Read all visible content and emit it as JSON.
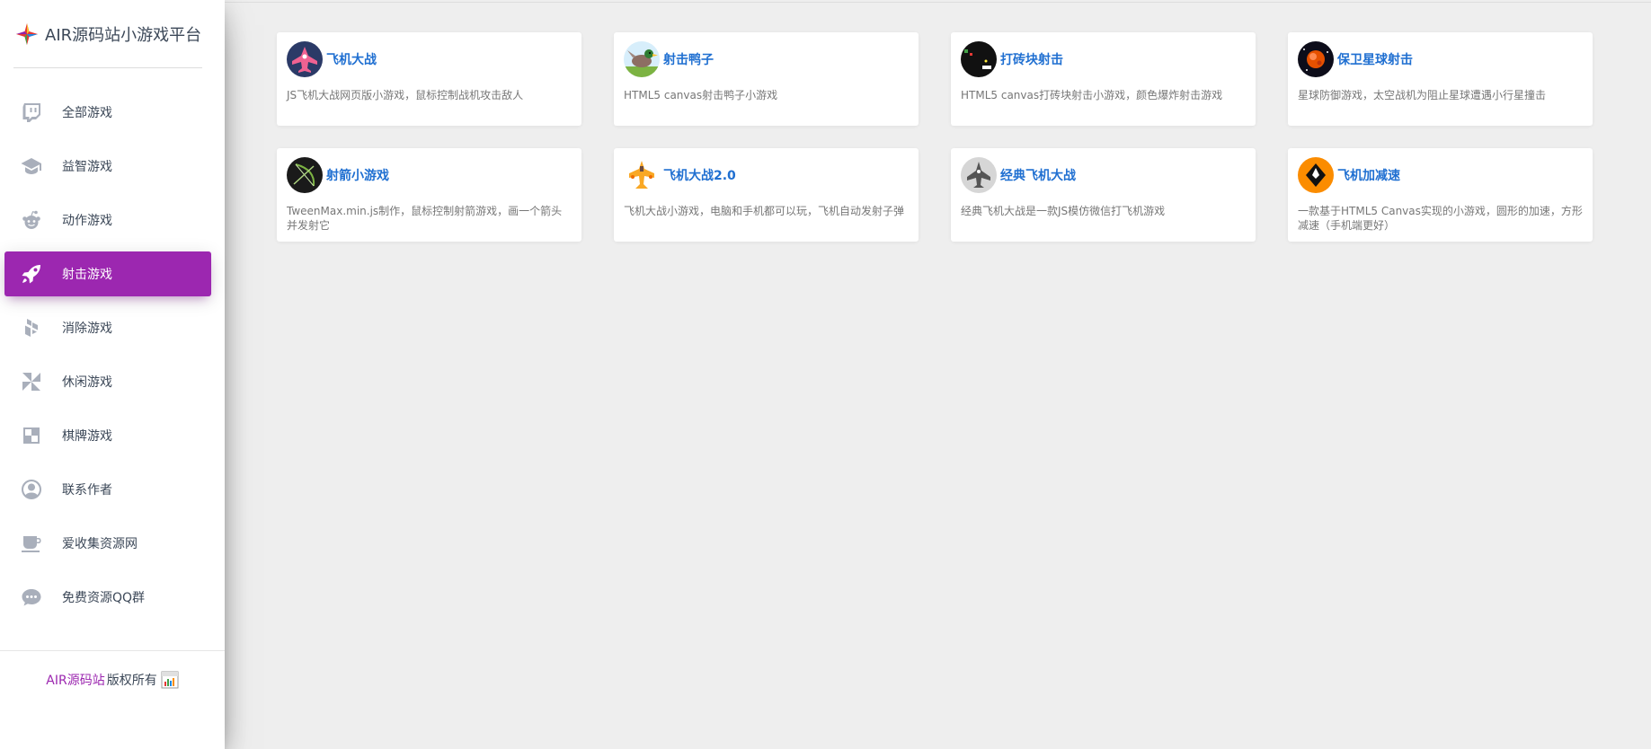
{
  "site": {
    "title": "AIR源码站小游戏平台",
    "logo_icon": "star-logo-icon"
  },
  "nav": {
    "items": [
      {
        "label": "全部游戏",
        "icon": "twitch-icon",
        "active": false
      },
      {
        "label": "益智游戏",
        "icon": "graduation-cap-icon",
        "active": false
      },
      {
        "label": "动作游戏",
        "icon": "reddit-icon",
        "active": false
      },
      {
        "label": "射击游戏",
        "icon": "rocket-icon",
        "active": true
      },
      {
        "label": "消除游戏",
        "icon": "hubspot-icon",
        "active": false
      },
      {
        "label": "休闲游戏",
        "icon": "pinwheel-icon",
        "active": false
      },
      {
        "label": "棋牌游戏",
        "icon": "checkerboard-icon",
        "active": false
      },
      {
        "label": "联系作者",
        "icon": "user-circle-icon",
        "active": false
      },
      {
        "label": "爱收集资源网",
        "icon": "coffee-icon",
        "active": false
      },
      {
        "label": "免费资源QQ群",
        "icon": "chat-bubble-icon",
        "active": false
      }
    ]
  },
  "footer": {
    "link": "AIR源码站",
    "text": "版权所有",
    "icon": "cnzz-stats-icon"
  },
  "games": [
    {
      "title": "飞机大战",
      "desc": "JS飞机大战网页版小游戏，鼠标控制战机攻击敌人",
      "thumb": "plane-thumb-icon"
    },
    {
      "title": "射击鸭子",
      "desc": "HTML5 canvas射击鸭子小游戏",
      "thumb": "duck-thumb-icon"
    },
    {
      "title": "打砖块射击",
      "desc": "HTML5 canvas打砖块射击小游戏，颜色爆炸射击游戏",
      "thumb": "brick-thumb-icon"
    },
    {
      "title": "保卫星球射击",
      "desc": "星球防御游戏，太空战机为阻止星球遭遇小行星撞击",
      "thumb": "planet-thumb-icon"
    },
    {
      "title": "射箭小游戏",
      "desc": "TweenMax.min.js制作，鼠标控制射箭游戏，画一个箭头并发射它",
      "thumb": "bow-thumb-icon"
    },
    {
      "title": "飞机大战2.0",
      "desc": "飞机大战小游戏，电脑和手机都可以玩，飞机自动发射子弹",
      "thumb": "plane2-thumb-icon"
    },
    {
      "title": "经典飞机大战",
      "desc": "经典飞机大战是一款JS模仿微信打飞机游戏",
      "thumb": "classic-plane-thumb-icon"
    },
    {
      "title": "飞机加减速",
      "desc": "一款基于HTML5 Canvas实现的小游戏，圆形的加速，方形减速（手机端更好）",
      "thumb": "speed-plane-thumb-icon"
    }
  ]
}
